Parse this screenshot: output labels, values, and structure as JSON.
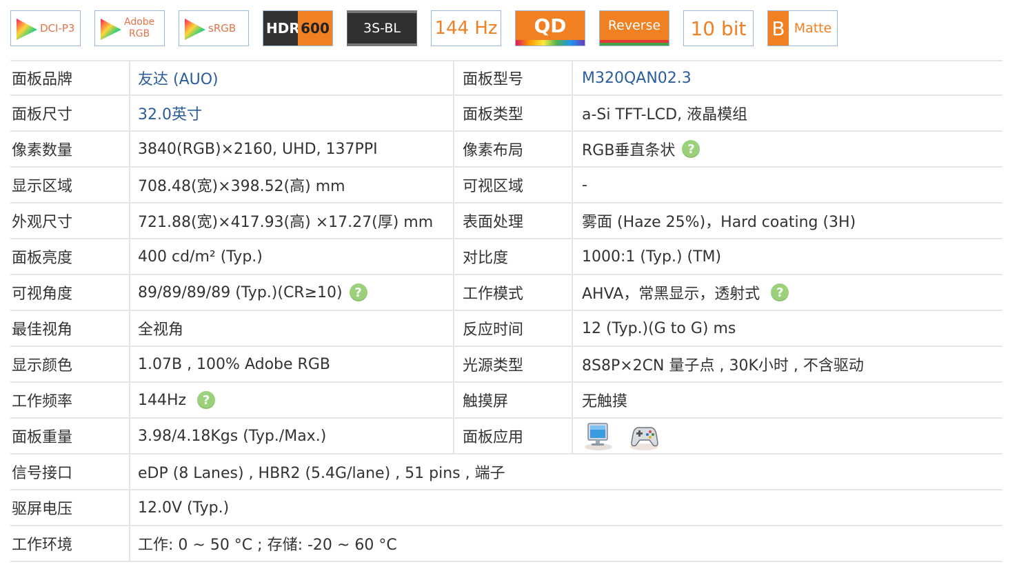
{
  "badges": {
    "dcip3": "DCI-P3",
    "adobe_line1": "Adobe",
    "adobe_line2": "RGB",
    "srgb": "sRGB",
    "hdr_text": "HDR",
    "hdr_level": "600",
    "backlight": "3S-BL",
    "refresh": "144 Hz",
    "qd": "QD",
    "reverse": "Reverse",
    "bit_depth": "10 bit",
    "matte_letter": "B",
    "matte": "Matte"
  },
  "icons": {
    "help": "?",
    "help_icon": "question-circle-icon",
    "application_icons": [
      "monitor-icon",
      "gamepad-icon"
    ]
  },
  "colors": {
    "brand_orange": "#f08022",
    "link_blue": "#2b5d9e",
    "help_green": "#9bd17a"
  },
  "specs": {
    "r1": {
      "k1": "面板品牌",
      "v1": "友达 (AUO)",
      "k2": "面板型号",
      "v2": "M320QAN02.3"
    },
    "r2": {
      "k1": "面板尺寸",
      "v1": "32.0英寸",
      "k2": "面板类型",
      "v2": "a-Si TFT-LCD, 液晶模组"
    },
    "r3": {
      "k1": "像素数量",
      "v1": "3840(RGB)×2160, UHD, 137PPI",
      "k2": "像素布局",
      "v2": "RGB垂直条状"
    },
    "r4": {
      "k1": "显示区域",
      "v1": "708.48(宽)×398.52(高) mm",
      "k2": "可视区域",
      "v2": "-"
    },
    "r5": {
      "k1": "外观尺寸",
      "v1": "721.88(宽)×417.93(高) ×17.27(厚) mm",
      "k2": "表面处理",
      "v2": "雾面 (Haze 25%)，Hard coating (3H)"
    },
    "r6": {
      "k1": "面板亮度",
      "v1": "400 cd/m² (Typ.)",
      "k2": "对比度",
      "v2": "1000:1 (Typ.) (TM)"
    },
    "r7": {
      "k1": "可视角度",
      "v1": "89/89/89/89 (Typ.)(CR≥10)",
      "k2": "工作模式",
      "v2": "AHVA，常黑显示，透射式"
    },
    "r8": {
      "k1": "最佳视角",
      "v1": "全视角",
      "k2": "反应时间",
      "v2": "12 (Typ.)(G to G) ms"
    },
    "r9": {
      "k1": "显示颜色",
      "v1": "1.07B , 100% Adobe RGB",
      "k2": "光源类型",
      "v2": "8S8P×2CN 量子点 , 30K小时 , 不含驱动"
    },
    "r10": {
      "k1": "工作频率",
      "v1": "144Hz",
      "k2": "触摸屏",
      "v2": "无触摸"
    },
    "r11": {
      "k1": "面板重量",
      "v1": "3.98/4.18Kgs (Typ./Max.)",
      "k2": "面板应用"
    },
    "r12": {
      "k1": "信号接口",
      "v1": "eDP (8 Lanes) , HBR2 (5.4G/lane) , 51 pins , 端子"
    },
    "r13": {
      "k1": "驱屏电压",
      "v1": "12.0V (Typ.)"
    },
    "r14": {
      "k1": "工作环境",
      "v1": "工作: 0 ~ 50 °C ; 存储: -20 ~ 60 °C"
    }
  }
}
